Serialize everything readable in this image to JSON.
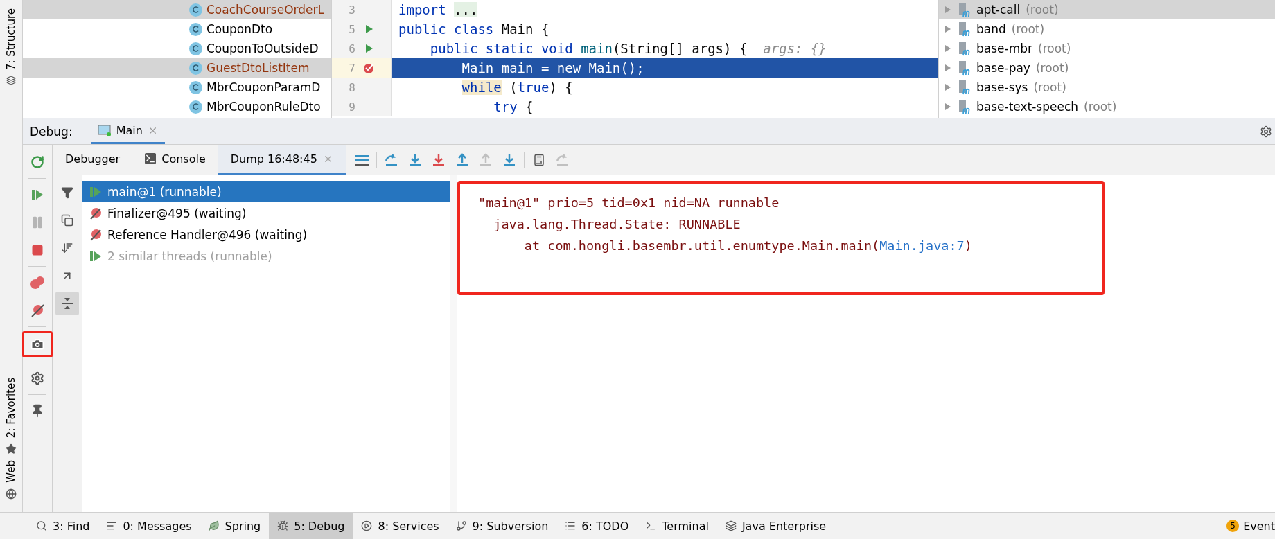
{
  "left_strip": {
    "top": [
      {
        "label": "7: Structure"
      }
    ],
    "bottom": [
      {
        "label": "2: Favorites"
      },
      {
        "label": "Web"
      }
    ]
  },
  "structure": {
    "items": [
      {
        "name": "CoachCourseOrderL",
        "selected": true,
        "modified": true
      },
      {
        "name": "CouponDto",
        "selected": false,
        "modified": false
      },
      {
        "name": "CouponToOutsideD",
        "selected": false,
        "modified": false
      },
      {
        "name": "GuestDtoListItem",
        "selected": true,
        "modified": true
      },
      {
        "name": "MbrCouponParamD",
        "selected": false,
        "modified": false
      },
      {
        "name": "MbrCouponRuleDto",
        "selected": false,
        "modified": false
      }
    ]
  },
  "editor": {
    "lines": [
      {
        "number": "3",
        "kind": "plain",
        "current": false,
        "tokens": [
          {
            "kind": "keyword",
            "text": "import"
          },
          {
            "kind": "folded",
            "text": " ..."
          }
        ]
      },
      {
        "number": "5",
        "kind": "run",
        "current": false,
        "tokens": [
          {
            "kind": "keyword",
            "text": "public class"
          },
          {
            "kind": "plain",
            "text": " Main {"
          }
        ]
      },
      {
        "number": "6",
        "kind": "run",
        "current": false,
        "tokens": [
          {
            "kind": "keyword",
            "text": "    public static void"
          },
          {
            "kind": "method",
            "text": " main"
          },
          {
            "kind": "plain",
            "text": "(String[] args) {"
          },
          {
            "kind": "hint",
            "text": "  args: {}"
          }
        ]
      },
      {
        "number": "7",
        "kind": "breakpoint",
        "current": true,
        "tokens": [
          {
            "kind": "plain",
            "text": "        Main main = new Main();"
          }
        ]
      },
      {
        "number": "8",
        "kind": "plain",
        "current": false,
        "tokens": [
          {
            "kind": "matched",
            "text": "        while"
          },
          {
            "kind": "plain",
            "text": " ("
          },
          {
            "kind": "keyword",
            "text": "true"
          },
          {
            "kind": "plain",
            "text": ") {"
          }
        ]
      },
      {
        "number": "9",
        "kind": "plain",
        "current": false,
        "tokens": [
          {
            "kind": "keyword",
            "text": "            try"
          },
          {
            "kind": "plain",
            "text": " {"
          }
        ]
      }
    ]
  },
  "project": {
    "items": [
      {
        "name": "apt-call",
        "suffix": "(root)",
        "selected": true
      },
      {
        "name": "band",
        "suffix": "(root)",
        "selected": false
      },
      {
        "name": "base-mbr",
        "suffix": "(root)",
        "selected": false
      },
      {
        "name": "base-pay",
        "suffix": "(root)",
        "selected": false
      },
      {
        "name": "base-sys",
        "suffix": "(root)",
        "selected": false
      },
      {
        "name": "base-text-speech",
        "suffix": "(root)",
        "selected": false
      }
    ]
  },
  "debug": {
    "title": "Debug:",
    "session": {
      "label": "Main"
    },
    "tabs": [
      {
        "label": "Debugger",
        "selected": false
      },
      {
        "label": "Console",
        "selected": false
      },
      {
        "label": "Dump 16:48:45",
        "selected": true
      }
    ],
    "snapshot_button": {
      "highlighted": true
    },
    "threads": [
      {
        "name": "main@1 (runnable)",
        "kind": "running",
        "selected": true,
        "dimmed": false
      },
      {
        "name": "Finalizer@495 (waiting)",
        "kind": "waiting",
        "selected": false,
        "dimmed": false
      },
      {
        "name": "Reference Handler@496 (waiting)",
        "kind": "waiting",
        "selected": false,
        "dimmed": false
      },
      {
        "name": "2 similar threads (runnable)",
        "kind": "running",
        "selected": false,
        "dimmed": true
      }
    ],
    "dump": {
      "highlighted": true,
      "lines": [
        {
          "text": "\"main@1\" prio=5 tid=0x1 nid=NA runnable"
        },
        {
          "text": "  java.lang.Thread.State: RUNNABLE"
        },
        {
          "text": "      at com.hongli.basembr.util.enumtype.Main.main(",
          "link": "Main.java:7",
          "after": ")"
        }
      ]
    }
  },
  "bottom_bar": {
    "tools": [
      {
        "label": "3: Find",
        "selected": false
      },
      {
        "label": "0: Messages",
        "selected": false
      },
      {
        "label": "Spring",
        "selected": false
      },
      {
        "label": "5: Debug",
        "selected": true
      },
      {
        "label": "8: Services",
        "selected": false
      },
      {
        "label": "9: Subversion",
        "selected": false
      },
      {
        "label": "6: TODO",
        "selected": false
      },
      {
        "label": "Terminal",
        "selected": false
      },
      {
        "label": "Java Enterprise",
        "selected": false
      }
    ],
    "event_count": "5",
    "event_label": "Event"
  }
}
